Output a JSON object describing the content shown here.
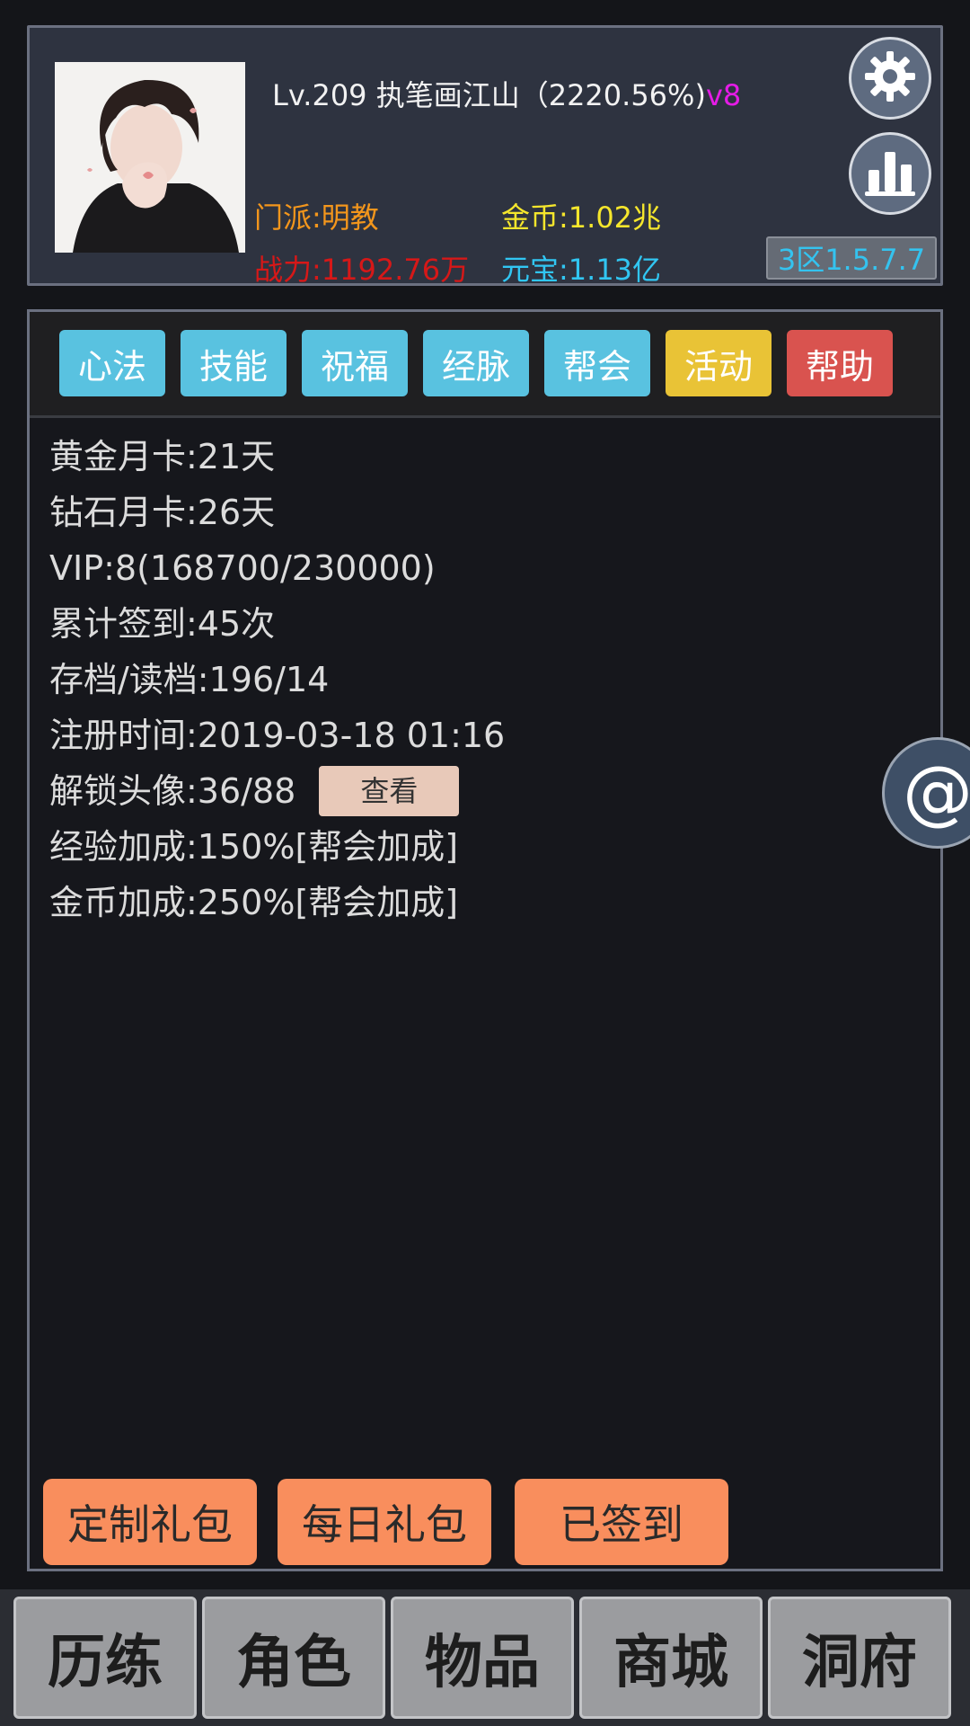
{
  "player": {
    "level_name": "Lv.209 执笔画江山（2220.56%)",
    "vip_tag": "v8",
    "sect": "门派:明教",
    "power": "战力:1192.76万",
    "gold": "金币:1.02兆",
    "ingot": "元宝:1.13亿",
    "server": "3区1.5.7.7"
  },
  "tabs": [
    {
      "label": "心法",
      "color": "#59c2e0"
    },
    {
      "label": "技能",
      "color": "#59c2e0"
    },
    {
      "label": "祝福",
      "color": "#59c2e0"
    },
    {
      "label": "经脉",
      "color": "#59c2e0"
    },
    {
      "label": "帮会",
      "color": "#59c2e0"
    },
    {
      "label": "活动",
      "color": "#e9c336"
    },
    {
      "label": "帮助",
      "color": "#d9534f"
    }
  ],
  "info": {
    "gold_card": "黄金月卡:21天",
    "diamond_card": "钻石月卡:26天",
    "vip": "VIP:8(168700/230000)",
    "signin": "累计签到:45次",
    "save_load": "存档/读档:196/14",
    "register": "注册时间:2019-03-18 01:16",
    "avatars": "解锁头像:36/88",
    "view_label": "查看",
    "exp_bonus": "经验加成:150%[帮会加成]",
    "gold_bonus": "金币加成:250%[帮会加成]"
  },
  "gifts": {
    "custom": "定制礼包",
    "daily": "每日礼包",
    "signed": "已签到"
  },
  "floating": {
    "at_symbol": "@"
  },
  "nav": [
    {
      "label": "历练"
    },
    {
      "label": "角色"
    },
    {
      "label": "物品"
    },
    {
      "label": "商城"
    },
    {
      "label": "洞府"
    }
  ],
  "icons": {
    "settings": "gear-icon",
    "ranking": "bar-chart-icon",
    "mention": "at-icon"
  }
}
